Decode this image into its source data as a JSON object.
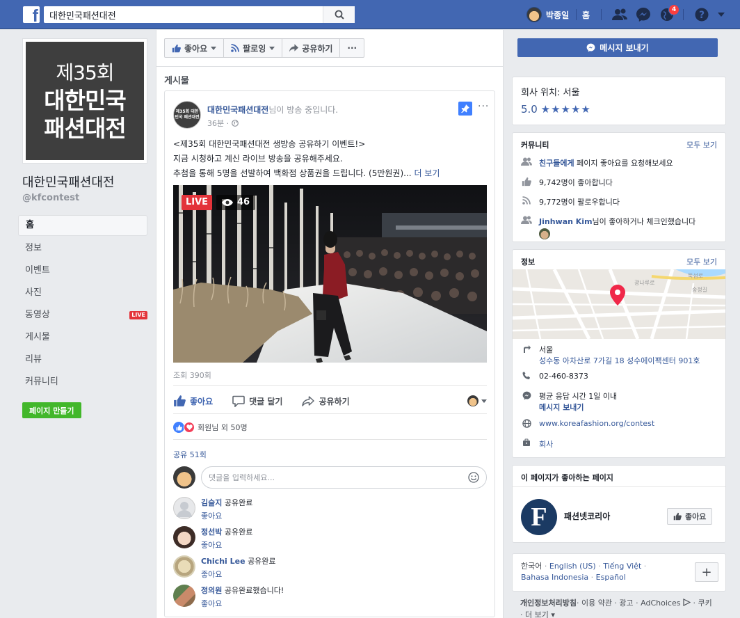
{
  "topbar": {
    "logo": "f",
    "search_value": "대한민국패션대전",
    "user_name": "박종일",
    "home_label": "홈",
    "notification_count": "4"
  },
  "left": {
    "profile_line1": "제35회",
    "profile_line2": "대한민국",
    "profile_line3": "패션대전",
    "page_name": "대한민국패션대전",
    "page_handle": "@kfcontest",
    "nav": [
      {
        "label": "홈"
      },
      {
        "label": "정보"
      },
      {
        "label": "이벤트"
      },
      {
        "label": "사진"
      },
      {
        "label": "동영상",
        "badge": "LIVE"
      },
      {
        "label": "게시물"
      },
      {
        "label": "리뷰"
      },
      {
        "label": "커뮤니티"
      }
    ],
    "create_page": "페이지 만들기"
  },
  "actionbar": {
    "like": "좋아요",
    "follow": "팔로잉",
    "share": "공유하기",
    "more": "···"
  },
  "posts_header": "게시물",
  "post": {
    "avatar_text": "제35회 대한민국 패션대전",
    "author": "대한민국패션대전",
    "author_suffix": "님이 방송 중입니다.",
    "time": "36분 · ",
    "more": "···",
    "line1": "<제35회 대한민국패션대전 생방송 공유하기 이벤트!>",
    "line2": "지금 시청하고 계신 라이브 방송을 공유해주세요.",
    "line3": "추첨을 통해 5명을 선발하여 백화점 상품권을 드립니다. (5만원권)...",
    "see_more": "더 보기",
    "live_label": "LIVE",
    "viewers": "46",
    "views": "조회 390회",
    "like": "좋아요",
    "comment": "댓글 달기",
    "share": "공유하기",
    "reactions": "회원님 외 50명",
    "shares": "공유 51회",
    "comment_placeholder": "댓글을 입력하세요...",
    "comments": [
      {
        "name": "김슬지",
        "text": "공유완료",
        "like": "좋아요"
      },
      {
        "name": "정선박",
        "text": "공유완료",
        "like": "좋아요"
      },
      {
        "name": "Chichi Lee",
        "text": "공유완료",
        "like": "좋아요"
      },
      {
        "name": "정의원",
        "text": "공유완료했습니다!",
        "like": "좋아요"
      }
    ]
  },
  "right": {
    "message_button": "메시지 보내기",
    "location": "회사 위치: 서울",
    "rating": "5.0",
    "stars": "★★★★★",
    "community": {
      "title": "커뮤니티",
      "see_all": "모두 보기",
      "invite_link": "친구들에게",
      "invite_text": " 페이지 좋아요를 요청해보세요",
      "likes": "9,742명이 좋아합니다",
      "follows": "9,772명이 팔로우합니다",
      "checkin_name": "Jinhwan Kim",
      "checkin_text": "님이 좋아하거나 체크인했습니다"
    },
    "info": {
      "title": "정보",
      "see_all": "모두 보기",
      "city": "서울",
      "address": "성수동 아차산로 7가길 18 성수에이팩센터 901호",
      "phone": "02-460-8373",
      "response": "평균 응답 시간 1일 이내",
      "message": "메시지 보내기",
      "website": "www.koreafashion.org/contest",
      "category": "회사"
    },
    "liked_pages": {
      "title": "이 페이지가 좋아하는 페이지",
      "name": "패션넷코리아",
      "like": "좋아요"
    },
    "languages": {
      "l1": "한국어",
      "l2": "English (US)",
      "l3": "Tiếng Việt",
      "l4": "Bahasa Indonesia",
      "l5": "Español",
      "plus": "+"
    },
    "footer": {
      "privacy": "개인정보처리방침",
      "terms": "· 이용 약관 · 광고 · AdChoices",
      "cookie": " · 쿠키",
      "more": "· 더 보기 ▾"
    }
  },
  "colors": {
    "brand": "#4267b2",
    "live": "#e3333a",
    "link": "#365899",
    "green": "#42b72a"
  }
}
